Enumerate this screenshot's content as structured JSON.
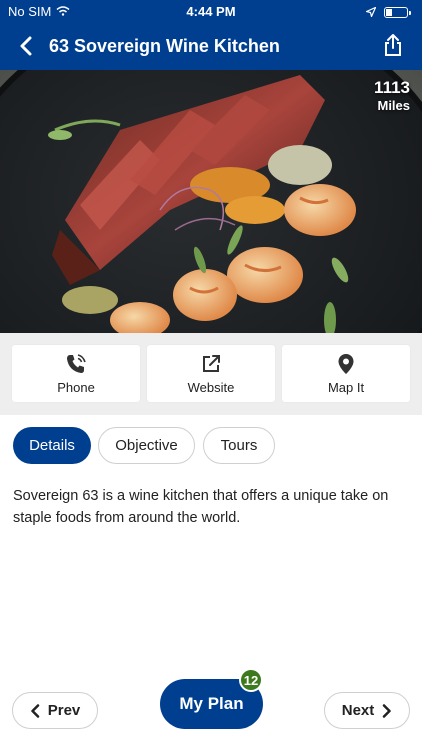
{
  "status_bar": {
    "carrier": "No SIM",
    "time": "4:44 PM"
  },
  "header": {
    "title": "63 Sovereign Wine Kitchen"
  },
  "hero": {
    "distance_value": "1113",
    "distance_unit": "Miles"
  },
  "actions": {
    "phone": "Phone",
    "website": "Website",
    "map": "Map It"
  },
  "tabs": [
    {
      "label": "Details",
      "active": true
    },
    {
      "label": "Objective",
      "active": false
    },
    {
      "label": "Tours",
      "active": false
    }
  ],
  "details": {
    "description": "Sovereign 63 is a wine kitchen that offers a unique take on staple foods from around the world."
  },
  "footer": {
    "prev_label": "Prev",
    "next_label": "Next",
    "myplan_label": "My Plan",
    "myplan_count": "12"
  },
  "colors": {
    "brand_blue": "#003f8f",
    "badge_green": "#3d7a1e",
    "panel_gray": "#eeeeee"
  },
  "icons": [
    "wifi-icon",
    "location-arrow-icon",
    "battery-icon",
    "back-chevron-icon",
    "share-icon",
    "phone-icon",
    "external-link-icon",
    "map-pin-icon",
    "chevron-left-icon",
    "chevron-right-icon"
  ]
}
